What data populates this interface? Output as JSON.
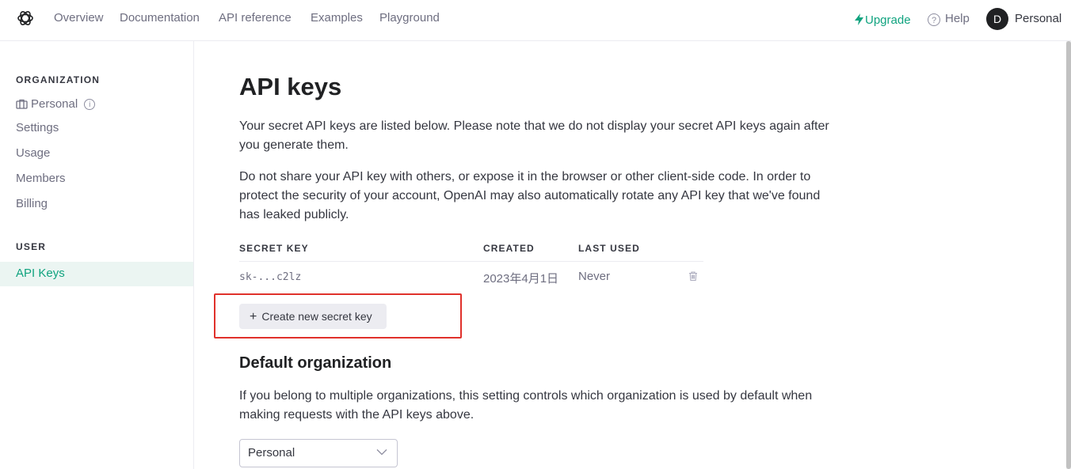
{
  "nav": {
    "links": [
      "Overview",
      "Documentation",
      "API reference",
      "Examples",
      "Playground"
    ],
    "upgrade": "Upgrade",
    "help": "Help",
    "help_glyph": "?",
    "avatar_initial": "D",
    "account": "Personal"
  },
  "sidebar": {
    "org_heading": "ORGANIZATION",
    "org_name": "Personal",
    "info_glyph": "i",
    "items": [
      "Settings",
      "Usage",
      "Members",
      "Billing"
    ],
    "user_heading": "USER",
    "active_item": "API Keys"
  },
  "main": {
    "title": "API keys",
    "intro": "Your secret API keys are listed below. Please note that we do not display your secret API keys again after you generate them.",
    "warning": "Do not share your API key with others, or expose it in the browser or other client-side code. In order to protect the security of your account, OpenAI may also automatically rotate any API key that we've found has leaked publicly.",
    "table": {
      "headers": [
        "SECRET KEY",
        "CREATED",
        "LAST USED"
      ],
      "rows": [
        {
          "key": "sk-...c2lz",
          "created": "2023年4月1日",
          "last_used": "Never"
        }
      ]
    },
    "create_button": "Create new secret key",
    "create_plus": "+",
    "default_org_heading": "Default organization",
    "default_org_text": "If you belong to multiple organizations, this setting controls which organization is used by default when making requests with the API keys above.",
    "org_select_value": "Personal"
  },
  "colors": {
    "accent": "#10a37f",
    "highlight_box": "#e0312b",
    "active_bg": "#ebf5f2"
  },
  "icons": [
    "openai-logo-icon",
    "lightning-icon",
    "help-icon",
    "briefcase-icon",
    "info-icon",
    "trash-icon",
    "plus-icon",
    "chevron-down-icon"
  ]
}
